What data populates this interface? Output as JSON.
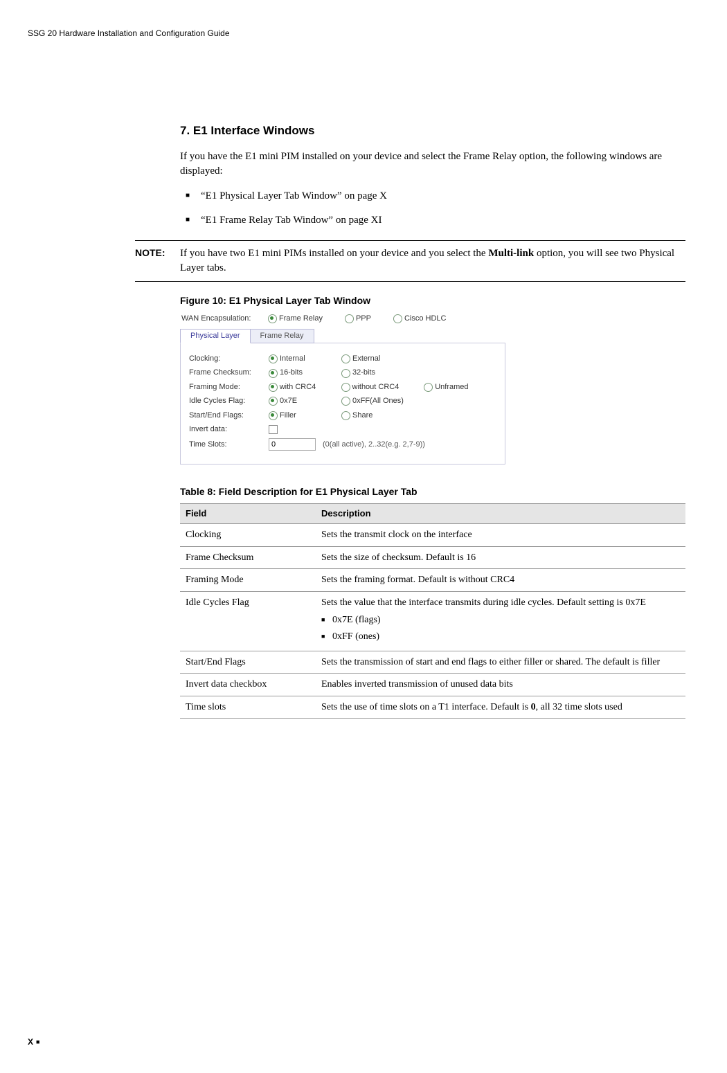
{
  "running_header": "SSG 20 Hardware Installation and Configuration Guide",
  "section": {
    "title": "7. E1 Interface Windows",
    "intro": "If you have the E1 mini PIM installed on your device and select the Frame Relay option, the following windows are displayed:",
    "bullets": [
      "“E1 Physical Layer Tab Window” on page X",
      "“E1 Frame Relay Tab Window” on page XI"
    ]
  },
  "note": {
    "label": "NOTE:",
    "text_pre": "If you have two E1 mini PIMs installed on your device and you select the ",
    "text_bold": "Multi-link",
    "text_post": " option, you will see two Physical Layer tabs."
  },
  "figure": {
    "caption": "Figure 10:  E1 Physical Layer Tab Window",
    "encapsulation": {
      "label": "WAN Encapsulation:",
      "options": [
        "Frame Relay",
        "PPP",
        "Cisco HDLC"
      ],
      "selected": 0
    },
    "tabs": {
      "active": "Physical Layer",
      "inactive": "Frame Relay"
    },
    "rows": {
      "clocking": {
        "label": "Clocking:",
        "opts": [
          "Internal",
          "External"
        ],
        "sel": 0
      },
      "checksum": {
        "label": "Frame Checksum:",
        "opts": [
          "16-bits",
          "32-bits"
        ],
        "sel": 0
      },
      "framing": {
        "label": "Framing Mode:",
        "opts": [
          "with CRC4",
          "without CRC4",
          "Unframed"
        ],
        "sel": 0
      },
      "idle": {
        "label": "Idle Cycles Flag:",
        "opts": [
          "0x7E",
          "0xFF(All Ones)"
        ],
        "sel": 0
      },
      "startend": {
        "label": "Start/End Flags:",
        "opts": [
          "Filler",
          "Share"
        ],
        "sel": 0
      },
      "invert": {
        "label": "Invert data:"
      },
      "timeslots": {
        "label": "Time Slots:",
        "value": "0",
        "hint": "(0(all active), 2..32(e.g. 2,7-9))"
      }
    }
  },
  "table": {
    "caption": "Table 8:  Field Description for E1 Physical Layer Tab",
    "headers": [
      "Field",
      "Description"
    ],
    "rows": [
      {
        "f": "Clocking",
        "d": "Sets the transmit clock on the interface"
      },
      {
        "f": "Frame Checksum",
        "d": "Sets the size of checksum. Default is 16"
      },
      {
        "f": "Framing Mode",
        "d": "Sets the framing format. Default is without CRC4"
      },
      {
        "f": "Idle Cycles Flag",
        "d": "Sets the value that the interface transmits during idle cycles. Default setting is 0x7E",
        "sub": [
          "0x7E (flags)",
          "0xFF (ones)"
        ]
      },
      {
        "f": "Start/End Flags",
        "d": "Sets the transmission of start and end flags to either filler or shared. The default is filler"
      },
      {
        "f": "Invert data checkbox",
        "d": "Enables inverted transmission of unused data bits"
      },
      {
        "f": "Time slots",
        "d_pre": "Sets the use of time slots on a T1 interface. Default is ",
        "d_bold": "0",
        "d_post": ", all 32 time slots used"
      }
    ]
  },
  "footer": {
    "page": "X"
  }
}
